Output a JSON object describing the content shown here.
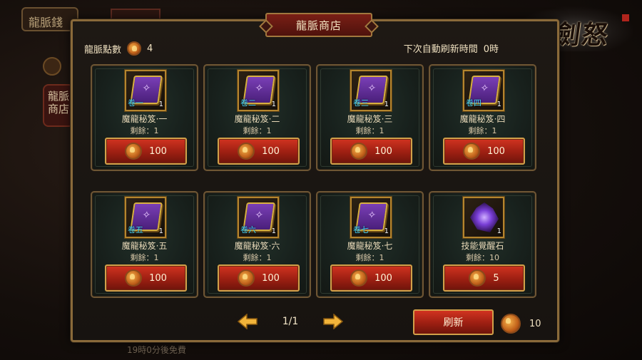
{
  "background": {
    "tab_label": "龍脈錢",
    "store_label": "龍脈商店",
    "footer_text": "19時0分後免費"
  },
  "logo": {
    "title": "刀劍怒"
  },
  "panel": {
    "title": "龍脈商店",
    "points_label": "龍脈點數",
    "points_value": "4",
    "refresh_label": "下次自動刷新時間",
    "refresh_value": "0時"
  },
  "items": [
    {
      "volume": "卷一",
      "qty": "1",
      "name": "魔龍秘笈·一",
      "remain": "剩餘：1",
      "price": "100",
      "icon": "purple-book-icon"
    },
    {
      "volume": "卷二",
      "qty": "1",
      "name": "魔龍秘笈·二",
      "remain": "剩餘：1",
      "price": "100",
      "icon": "purple-book-icon"
    },
    {
      "volume": "卷三",
      "qty": "1",
      "name": "魔龍秘笈·三",
      "remain": "剩餘：1",
      "price": "100",
      "icon": "purple-book-icon"
    },
    {
      "volume": "卷四",
      "qty": "1",
      "name": "魔龍秘笈·四",
      "remain": "剩餘：1",
      "price": "100",
      "icon": "purple-book-icon"
    },
    {
      "volume": "卷五",
      "qty": "1",
      "name": "魔龍秘笈·五",
      "remain": "剩餘：1",
      "price": "100",
      "icon": "purple-book-icon"
    },
    {
      "volume": "卷六",
      "qty": "1",
      "name": "魔龍秘笈·六",
      "remain": "剩餘：1",
      "price": "100",
      "icon": "purple-book-icon"
    },
    {
      "volume": "卷七",
      "qty": "1",
      "name": "魔龍秘笈·七",
      "remain": "剩餘：1",
      "price": "100",
      "icon": "purple-book-icon"
    },
    {
      "volume": "",
      "qty": "1",
      "name": "技能覺醒石",
      "remain": "剩餘：10",
      "price": "5",
      "icon": "purple-crystal-icon"
    }
  ],
  "pager": {
    "page": "1/1"
  },
  "refresh": {
    "label": "刷新",
    "cost": "10"
  }
}
